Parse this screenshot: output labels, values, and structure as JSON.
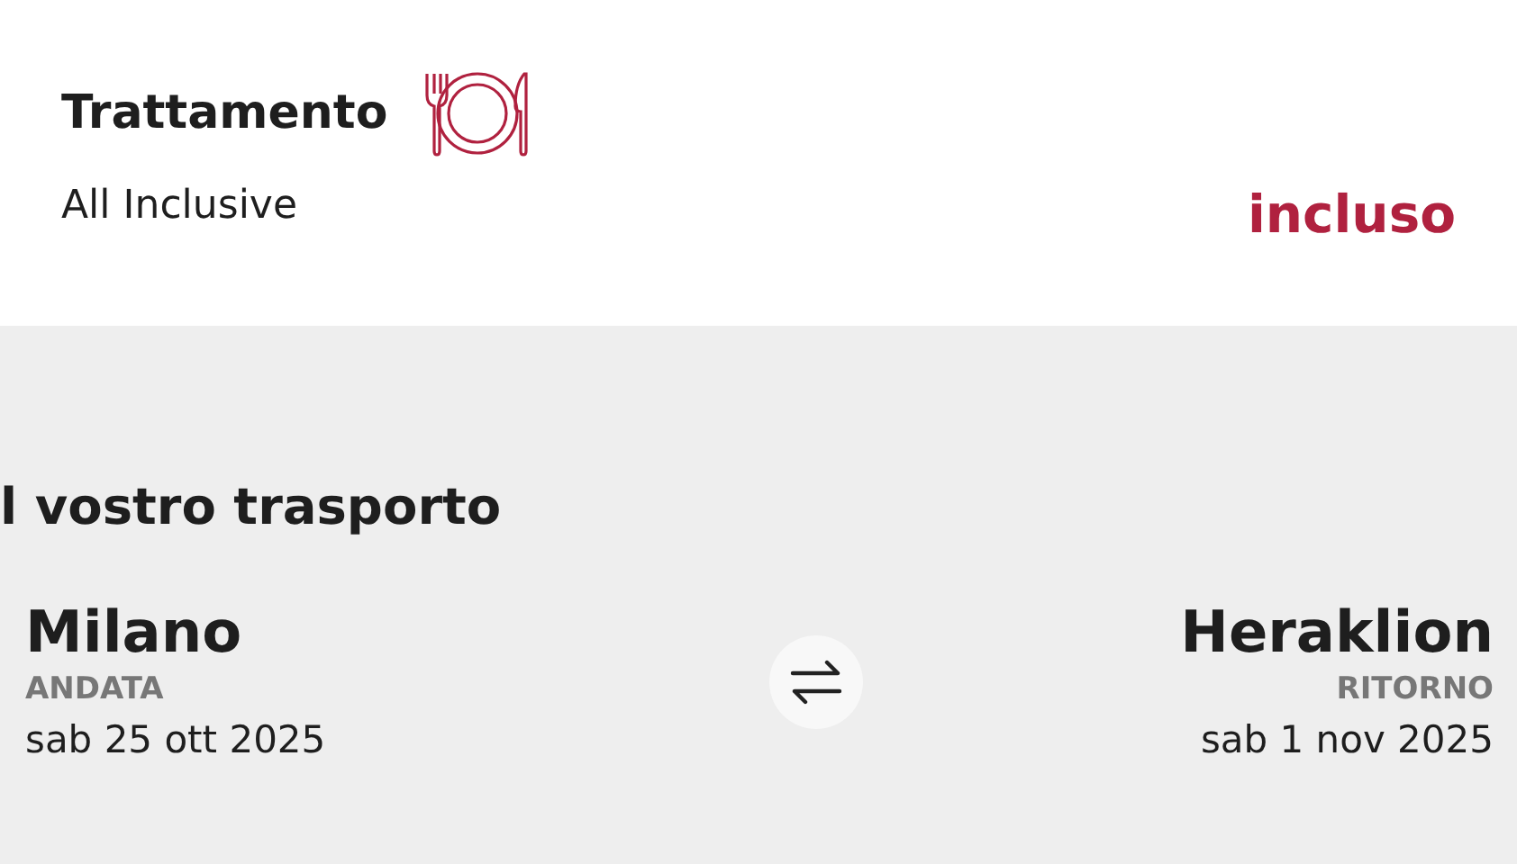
{
  "board": {
    "title": "Trattamento",
    "value": "All Inclusive",
    "price": "incluso"
  },
  "transport": {
    "title": "l vostro trasporto",
    "legs": [
      {
        "city": "Milano",
        "label": "ANDATA",
        "date": "sab 25 ott 2025"
      },
      {
        "city": "Heraklion",
        "label": "RITORNO",
        "date": "sab 1 nov 2025"
      }
    ]
  }
}
